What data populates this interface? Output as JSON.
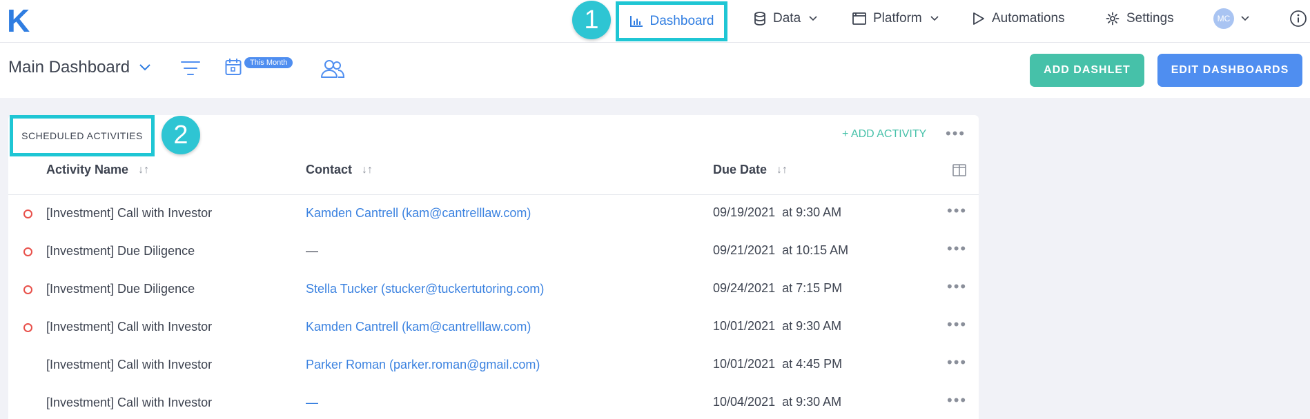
{
  "nav": {
    "logo": "K",
    "dashboard": "Dashboard",
    "data": "Data",
    "platform": "Platform",
    "automations": "Automations",
    "settings": "Settings",
    "avatar_initials": "MC",
    "info": "i"
  },
  "callouts": {
    "one": "1",
    "two": "2"
  },
  "toolbar": {
    "title": "Main Dashboard",
    "month_badge": "This Month",
    "add_dashlet": "ADD DASHLET",
    "edit_dashboards": "EDIT DASHBOARDS"
  },
  "card": {
    "title": "SCHEDULED ACTIVITIES",
    "add_activity": "+ ADD ACTIVITY",
    "more": "•••",
    "columns": {
      "activity": "Activity Name",
      "contact": "Contact",
      "due": "Due Date",
      "sort": "↓↑"
    },
    "rows": [
      {
        "status": true,
        "name": "[Investment] Call with Investor",
        "contact": "Kamden Cantrell (kam@cantrelllaw.com)",
        "date": "09/19/2021",
        "time": "at 9:30 AM",
        "more": "•••"
      },
      {
        "status": true,
        "name": "[Investment] Due Diligence",
        "contact": "—",
        "date": "09/21/2021",
        "time": "at 10:15 AM",
        "more": "•••"
      },
      {
        "status": true,
        "name": "[Investment] Due Diligence",
        "contact": "Stella Tucker (stucker@tuckertutoring.com)",
        "date": "09/24/2021",
        "time": "at 7:15 PM",
        "more": "•••"
      },
      {
        "status": true,
        "name": "[Investment] Call with Investor",
        "contact": "Kamden Cantrell (kam@cantrelllaw.com)",
        "date": "10/01/2021",
        "time": "at 9:30 AM",
        "more": "•••"
      },
      {
        "status": false,
        "name": "[Investment] Call with Investor",
        "contact": "Parker Roman (parker.roman@gmail.com)",
        "date": "10/01/2021",
        "time": "at 4:45 PM",
        "more": "•••"
      },
      {
        "status": false,
        "name": "[Investment] Call with Investor",
        "contact": "—",
        "date": "10/04/2021",
        "time": "at 9:30 AM",
        "more": "•••"
      }
    ]
  },
  "colors": {
    "accent_blue": "#2f7de1",
    "highlight_cyan": "#1fc6d4",
    "teal_button": "#46c1a9",
    "blue_button": "#4f8ef0",
    "status_red": "#e8504a"
  }
}
